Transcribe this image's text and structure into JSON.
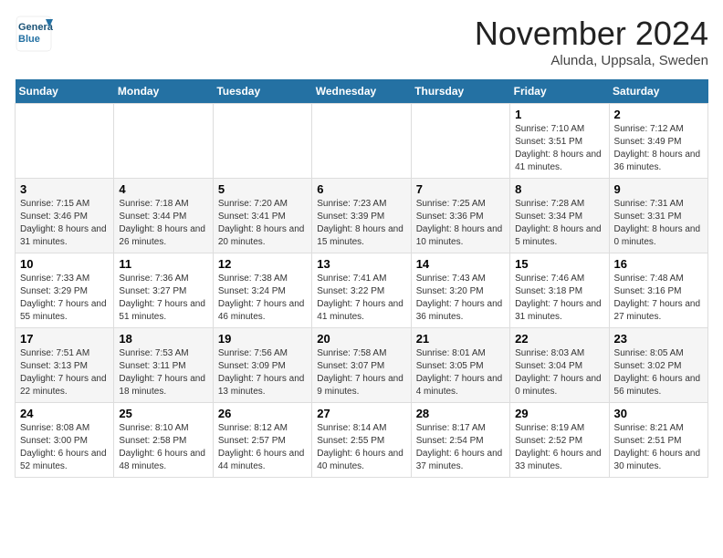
{
  "logo": {
    "line1": "General",
    "line2": "Blue"
  },
  "title": "November 2024",
  "subtitle": "Alunda, Uppsala, Sweden",
  "days_header": [
    "Sunday",
    "Monday",
    "Tuesday",
    "Wednesday",
    "Thursday",
    "Friday",
    "Saturday"
  ],
  "weeks": [
    [
      {
        "day": "",
        "info": ""
      },
      {
        "day": "",
        "info": ""
      },
      {
        "day": "",
        "info": ""
      },
      {
        "day": "",
        "info": ""
      },
      {
        "day": "",
        "info": ""
      },
      {
        "day": "1",
        "info": "Sunrise: 7:10 AM\nSunset: 3:51 PM\nDaylight: 8 hours and 41 minutes."
      },
      {
        "day": "2",
        "info": "Sunrise: 7:12 AM\nSunset: 3:49 PM\nDaylight: 8 hours and 36 minutes."
      }
    ],
    [
      {
        "day": "3",
        "info": "Sunrise: 7:15 AM\nSunset: 3:46 PM\nDaylight: 8 hours and 31 minutes."
      },
      {
        "day": "4",
        "info": "Sunrise: 7:18 AM\nSunset: 3:44 PM\nDaylight: 8 hours and 26 minutes."
      },
      {
        "day": "5",
        "info": "Sunrise: 7:20 AM\nSunset: 3:41 PM\nDaylight: 8 hours and 20 minutes."
      },
      {
        "day": "6",
        "info": "Sunrise: 7:23 AM\nSunset: 3:39 PM\nDaylight: 8 hours and 15 minutes."
      },
      {
        "day": "7",
        "info": "Sunrise: 7:25 AM\nSunset: 3:36 PM\nDaylight: 8 hours and 10 minutes."
      },
      {
        "day": "8",
        "info": "Sunrise: 7:28 AM\nSunset: 3:34 PM\nDaylight: 8 hours and 5 minutes."
      },
      {
        "day": "9",
        "info": "Sunrise: 7:31 AM\nSunset: 3:31 PM\nDaylight: 8 hours and 0 minutes."
      }
    ],
    [
      {
        "day": "10",
        "info": "Sunrise: 7:33 AM\nSunset: 3:29 PM\nDaylight: 7 hours and 55 minutes."
      },
      {
        "day": "11",
        "info": "Sunrise: 7:36 AM\nSunset: 3:27 PM\nDaylight: 7 hours and 51 minutes."
      },
      {
        "day": "12",
        "info": "Sunrise: 7:38 AM\nSunset: 3:24 PM\nDaylight: 7 hours and 46 minutes."
      },
      {
        "day": "13",
        "info": "Sunrise: 7:41 AM\nSunset: 3:22 PM\nDaylight: 7 hours and 41 minutes."
      },
      {
        "day": "14",
        "info": "Sunrise: 7:43 AM\nSunset: 3:20 PM\nDaylight: 7 hours and 36 minutes."
      },
      {
        "day": "15",
        "info": "Sunrise: 7:46 AM\nSunset: 3:18 PM\nDaylight: 7 hours and 31 minutes."
      },
      {
        "day": "16",
        "info": "Sunrise: 7:48 AM\nSunset: 3:16 PM\nDaylight: 7 hours and 27 minutes."
      }
    ],
    [
      {
        "day": "17",
        "info": "Sunrise: 7:51 AM\nSunset: 3:13 PM\nDaylight: 7 hours and 22 minutes."
      },
      {
        "day": "18",
        "info": "Sunrise: 7:53 AM\nSunset: 3:11 PM\nDaylight: 7 hours and 18 minutes."
      },
      {
        "day": "19",
        "info": "Sunrise: 7:56 AM\nSunset: 3:09 PM\nDaylight: 7 hours and 13 minutes."
      },
      {
        "day": "20",
        "info": "Sunrise: 7:58 AM\nSunset: 3:07 PM\nDaylight: 7 hours and 9 minutes."
      },
      {
        "day": "21",
        "info": "Sunrise: 8:01 AM\nSunset: 3:05 PM\nDaylight: 7 hours and 4 minutes."
      },
      {
        "day": "22",
        "info": "Sunrise: 8:03 AM\nSunset: 3:04 PM\nDaylight: 7 hours and 0 minutes."
      },
      {
        "day": "23",
        "info": "Sunrise: 8:05 AM\nSunset: 3:02 PM\nDaylight: 6 hours and 56 minutes."
      }
    ],
    [
      {
        "day": "24",
        "info": "Sunrise: 8:08 AM\nSunset: 3:00 PM\nDaylight: 6 hours and 52 minutes."
      },
      {
        "day": "25",
        "info": "Sunrise: 8:10 AM\nSunset: 2:58 PM\nDaylight: 6 hours and 48 minutes."
      },
      {
        "day": "26",
        "info": "Sunrise: 8:12 AM\nSunset: 2:57 PM\nDaylight: 6 hours and 44 minutes."
      },
      {
        "day": "27",
        "info": "Sunrise: 8:14 AM\nSunset: 2:55 PM\nDaylight: 6 hours and 40 minutes."
      },
      {
        "day": "28",
        "info": "Sunrise: 8:17 AM\nSunset: 2:54 PM\nDaylight: 6 hours and 37 minutes."
      },
      {
        "day": "29",
        "info": "Sunrise: 8:19 AM\nSunset: 2:52 PM\nDaylight: 6 hours and 33 minutes."
      },
      {
        "day": "30",
        "info": "Sunrise: 8:21 AM\nSunset: 2:51 PM\nDaylight: 6 hours and 30 minutes."
      }
    ]
  ]
}
